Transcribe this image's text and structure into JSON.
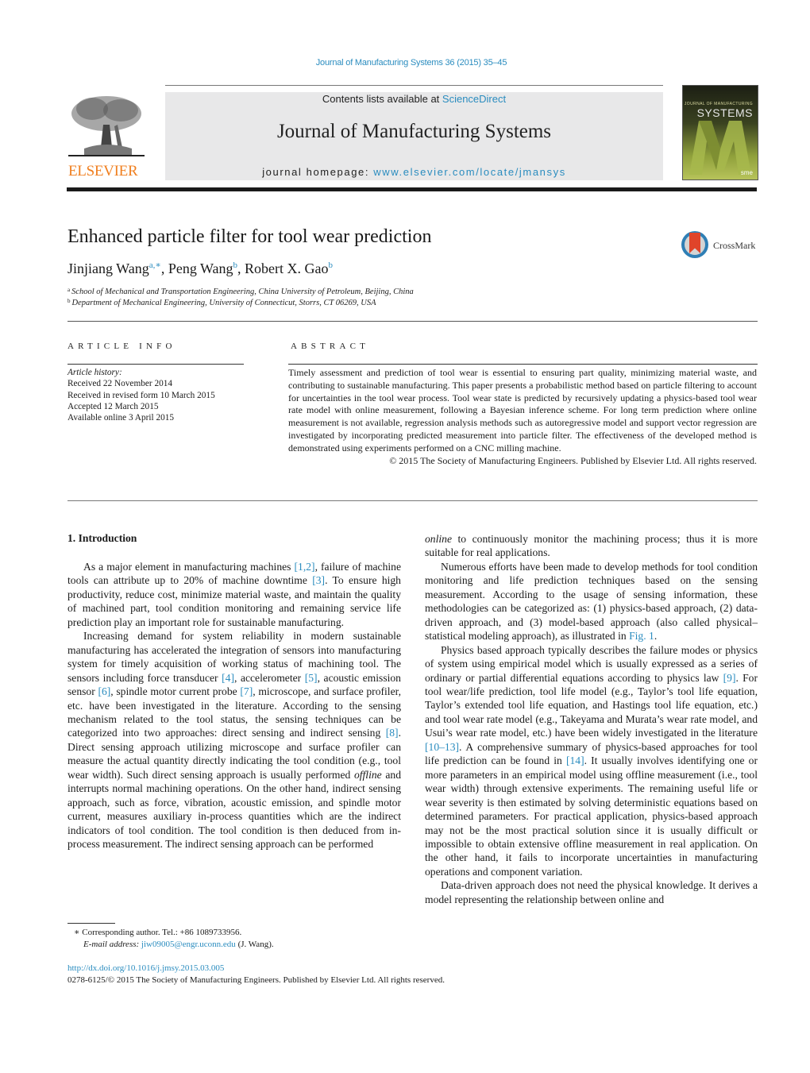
{
  "header": {
    "journal_ref": "Journal of Manufacturing Systems 36 (2015) 35–45",
    "contents_prefix": "Contents lists available at ",
    "contents_link": "ScienceDirect",
    "journal_title": "Journal of Manufacturing Systems",
    "homepage_prefix": "journal homepage: ",
    "homepage_link": "www.elsevier.com/locate/jmansys",
    "publisher_logo_text": "ELSEVIER",
    "cover": {
      "title_small": "JOURNAL OF MANUFACTURING",
      "title_big": "SYSTEMS",
      "badge": "sme"
    },
    "brand_color": "#f07f1f",
    "link_color": "#2a8cbf"
  },
  "article": {
    "title": "Enhanced particle filter for tool wear prediction",
    "crossmark_label": "CrossMark",
    "authors": [
      {
        "name": "Jinjiang Wang",
        "sup": "a,∗",
        "sep": ", "
      },
      {
        "name": "Peng Wang",
        "sup": "b",
        "sep": ", "
      },
      {
        "name": "Robert X. Gao",
        "sup": "b",
        "sep": ""
      }
    ],
    "affiliations": [
      {
        "mark": "a",
        "text": "School of Mechanical and Transportation Engineering, China University of Petroleum, Beijing, China"
      },
      {
        "mark": "b",
        "text": "Department of Mechanical Engineering, University of Connecticut, Storrs, CT 06269, USA"
      }
    ]
  },
  "article_info": {
    "label": "ARTICLE INFO",
    "history_label": "Article history:",
    "history": [
      "Received 22 November 2014",
      "Received in revised form 10 March 2015",
      "Accepted 12 March 2015",
      "Available online 3 April 2015"
    ]
  },
  "abstract": {
    "label": "ABSTRACT",
    "text": "Timely assessment and prediction of tool wear is essential to ensuring part quality, minimizing material waste, and contributing to sustainable manufacturing. This paper presents a probabilistic method based on particle filtering to account for uncertainties in the tool wear process. Tool wear state is predicted by recursively updating a physics-based tool wear rate model with online measurement, following a Bayesian inference scheme. For long term prediction where online measurement is not available, regression analysis methods such as autoregressive model and support vector regression are investigated by incorporating predicted measurement into particle filter. The effectiveness of the developed method is demonstrated using experiments performed on a CNC milling machine.",
    "copyright": "© 2015 The Society of Manufacturing Engineers. Published by Elsevier Ltd. All rights reserved."
  },
  "body": {
    "section_heading": "1.  Introduction",
    "left": {
      "p1": {
        "t1": "As a major element in manufacturing machines ",
        "r1": "[1,2]",
        "t2": ", failure of machine tools can attribute up to 20% of machine downtime ",
        "r2": "[3]",
        "t3": ". To ensure high productivity, reduce cost, minimize material waste, and maintain the quality of machined part, tool condition monitoring and remaining service life prediction play an important role for sustainable manufacturing."
      },
      "p2": {
        "t1": "Increasing demand for system reliability in modern sustainable manufacturing has accelerated the integration of sensors into manufacturing system for timely acquisition of working status of machining tool. The sensors including force transducer ",
        "r1": "[4]",
        "t2": ", accelerometer ",
        "r2": "[5]",
        "t3": ", acoustic emission sensor ",
        "r3": "[6]",
        "t4": ", spindle motor current probe ",
        "r4": "[7]",
        "t5": ", microscope, and surface profiler, etc. have been investigated in the literature. According to the sensing mechanism related to the tool status, the sensing techniques can be categorized into two approaches: direct sensing and indirect sensing ",
        "r5": "[8]",
        "t6": ". Direct sensing approach utilizing microscope and surface profiler can measure the actual quantity directly indicating the tool condition (e.g., tool wear width). Such direct sensing approach is usually performed ",
        "em": "offline",
        "t7": " and interrupts normal machining operations. On the other hand, indirect sensing approach, such as force, vibration, acoustic emission, and spindle motor current, measures auxiliary in-process quantities which are the indirect indicators of tool condition. The tool condition is then deduced from in-process measurement. The indirect sensing approach can be performed"
      }
    },
    "right": {
      "p0": {
        "em": "online",
        "t1": " to continuously monitor the machining process; thus it is more suitable for real applications."
      },
      "p1": {
        "t1": "Numerous efforts have been made to develop methods for tool condition monitoring and life prediction techniques based on the sensing measurement. According to the usage of sensing information, these methodologies can be categorized as: (1) physics-based approach, (2) data-driven approach, and (3) model-based approach (also called physical–statistical modeling approach), as illustrated in ",
        "r1": "Fig. 1",
        "t2": "."
      },
      "p2": {
        "t1": "Physics based approach typically describes the failure modes or physics of system using empirical model which is usually expressed as a series of ordinary or partial differential equations according to physics law ",
        "r1": "[9]",
        "t2": ". For tool wear/life prediction, tool life model (e.g., Taylor’s tool life equation, Taylor’s extended tool life equation, and Hastings tool life equation, etc.) and tool wear rate model (e.g., Takeyama and Murata’s wear rate model, and Usui’s wear rate model, etc.) have been widely investigated in the literature ",
        "r2": "[10–13]",
        "t3": ". A comprehensive summary of physics-based approaches for tool life prediction can be found in ",
        "r3": "[14]",
        "t4": ". It usually involves identifying one or more parameters in an empirical model using offline measurement (i.e., tool wear width) through extensive experiments. The remaining useful life or wear severity is then estimated by solving deterministic equations based on determined parameters. For practical application, physics-based approach may not be the most practical solution since it is usually difficult or impossible to obtain extensive offline measurement in real application. On the other hand, it fails to incorporate uncertainties in manufacturing operations and component variation."
      },
      "p3": {
        "t1": "Data-driven approach does not need the physical knowledge. It derives a model representing the relationship between online and"
      }
    }
  },
  "footer": {
    "footnote_mark": "∗",
    "footnote_text": " Corresponding author. Tel.: +86 1089733956.",
    "email_label": "E-mail address: ",
    "email": "jiw09005@engr.uconn.edu",
    "email_suffix": " (J. Wang).",
    "doi": "http://dx.doi.org/10.1016/j.jmsy.2015.03.005",
    "issn_line": "0278-6125/© 2015 The Society of Manufacturing Engineers. Published by Elsevier Ltd. All rights reserved."
  }
}
